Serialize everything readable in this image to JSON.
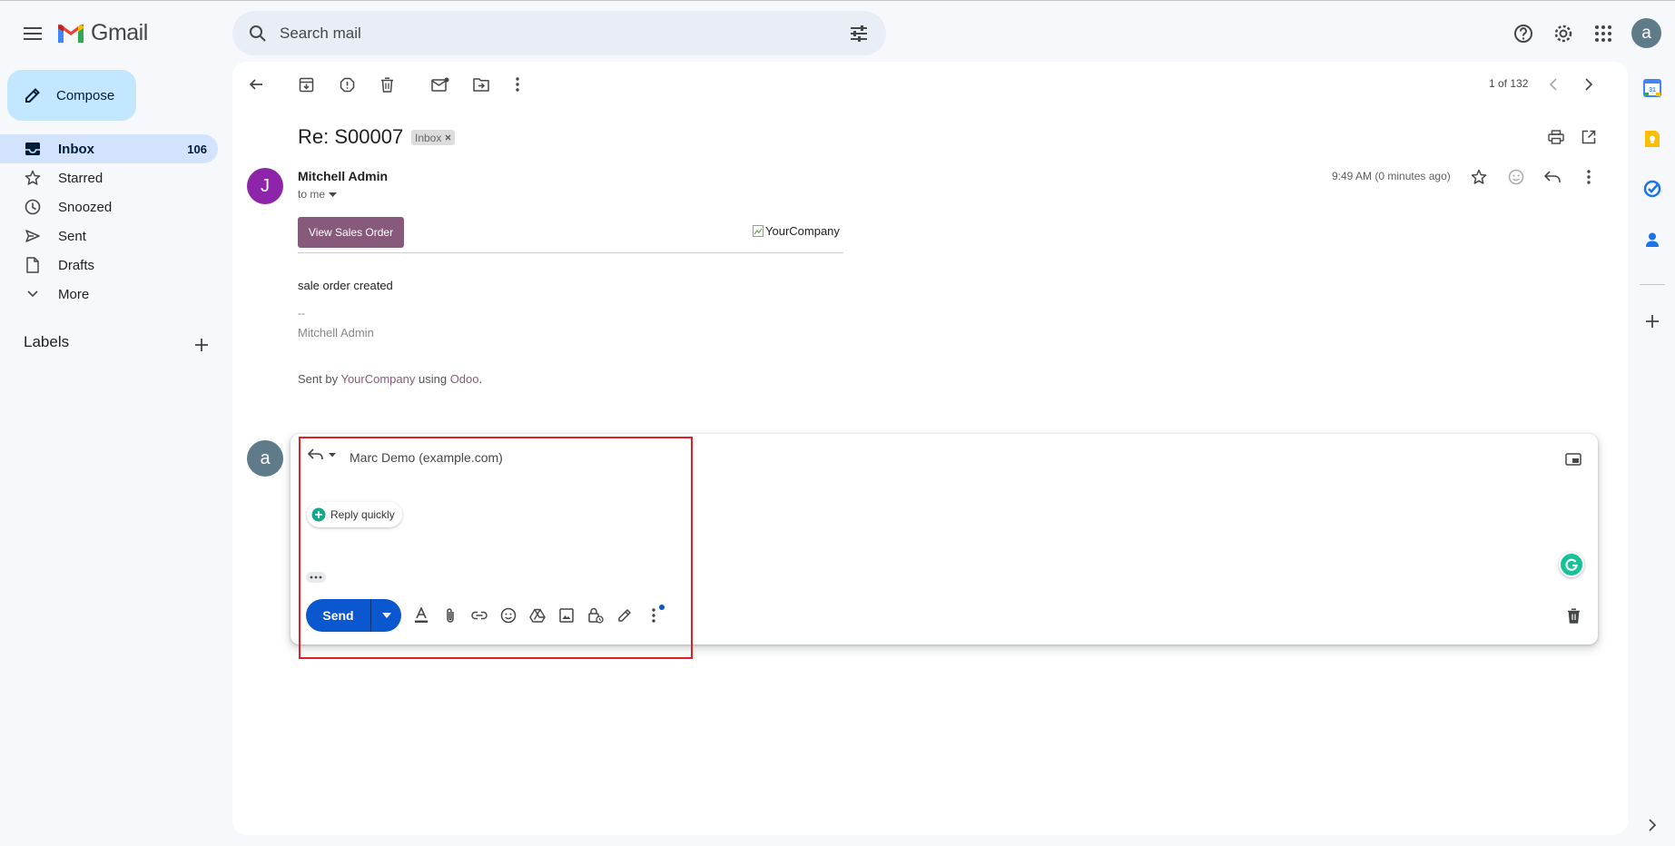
{
  "app": {
    "name": "Gmail"
  },
  "search": {
    "placeholder": "Search mail"
  },
  "account": {
    "avatar_letter": "a"
  },
  "compose": {
    "label": "Compose"
  },
  "nav": {
    "items": [
      {
        "label": "Inbox",
        "count": "106",
        "icon": "inbox-icon",
        "active": true
      },
      {
        "label": "Starred",
        "icon": "star-icon"
      },
      {
        "label": "Snoozed",
        "icon": "clock-icon"
      },
      {
        "label": "Sent",
        "icon": "send-icon"
      },
      {
        "label": "Drafts",
        "icon": "draft-icon"
      },
      {
        "label": "More",
        "icon": "chevron-down-icon"
      }
    ],
    "labels_heading": "Labels"
  },
  "toolbar": {
    "pager": "1 of 132"
  },
  "email": {
    "subject": "Re: S00007",
    "chip": "Inbox",
    "sender_initial": "J",
    "sender_name": "Mitchell Admin",
    "to_label": "to me",
    "timestamp": "9:49 AM (0 minutes ago)",
    "button_label": "View Sales Order",
    "logo_alt": "YourCompany",
    "body": "sale order created",
    "signature_dash": "--",
    "signature_name": "Mitchell Admin",
    "sent_by_prefix": "Sent by ",
    "sent_by_company": "YourCompany",
    "sent_by_mid": " using ",
    "sent_by_product": "Odoo",
    "sent_by_suffix": "."
  },
  "reply": {
    "avatar_letter": "a",
    "recipient": "Marc Demo (example.com)",
    "quick_reply_label": "Reply quickly",
    "send_label": "Send"
  },
  "colors": {
    "accent": "#0b57d0",
    "compose_bg": "#c2e7ff",
    "nav_active": "#d3e3fd",
    "odoo_purple": "#875a7b",
    "sender_avatar": "#8e24aa",
    "highlight_box": "#e01f26"
  }
}
